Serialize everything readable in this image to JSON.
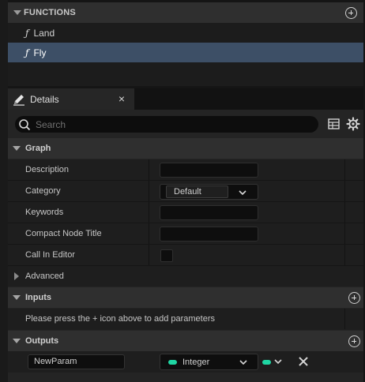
{
  "functions": {
    "header": "FUNCTIONS",
    "items": [
      {
        "label": "Land",
        "selected": false
      },
      {
        "label": "Fly",
        "selected": true
      }
    ]
  },
  "details_tab": {
    "label": "Details",
    "close": "×"
  },
  "search": {
    "placeholder": "Search"
  },
  "sections": {
    "graph": "Graph",
    "inputs": "Inputs",
    "outputs": "Outputs"
  },
  "graph_rows": {
    "description": {
      "label": "Description",
      "value": ""
    },
    "category": {
      "label": "Category",
      "value": "Default"
    },
    "keywords": {
      "label": "Keywords",
      "value": ""
    },
    "compact_node_title": {
      "label": "Compact Node Title",
      "value": ""
    },
    "call_in_editor": {
      "label": "Call In Editor",
      "checked": false
    }
  },
  "advanced": {
    "label": "Advanced"
  },
  "inputs_message": "Please press the + icon above to add parameters",
  "outputs_param": {
    "name": "NewParam",
    "type": "Integer",
    "type_color": "#1fd6a3"
  },
  "colors": {
    "selection": "#3d4f66",
    "integer_pin": "#1fd6a3"
  }
}
